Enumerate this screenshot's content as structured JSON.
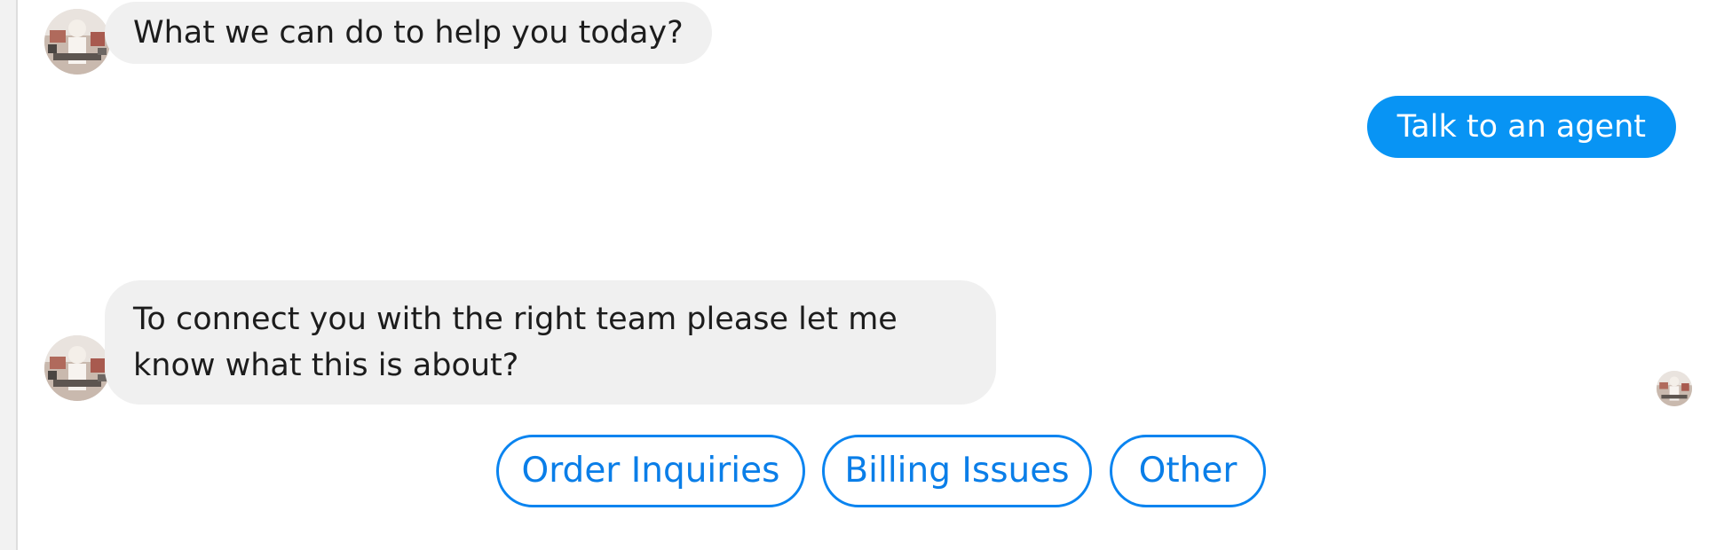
{
  "messages": [
    {
      "from": "bot",
      "text": "What we can do to help you today?"
    },
    {
      "from": "user",
      "text": "Talk to an agent"
    },
    {
      "from": "bot",
      "line1": "To connect you with the right team please let me",
      "line2": "know what this is about?"
    }
  ],
  "quick_replies": [
    "Order Inquiries",
    "Billing Issues",
    "Other"
  ],
  "colors": {
    "outgoing_bubble": "#0894f4",
    "incoming_bubble": "#f0f0f0",
    "quick_reply_accent": "#0a84f0"
  },
  "icons": [
    "bot-avatar-icon",
    "read-receipt-avatar-icon"
  ]
}
